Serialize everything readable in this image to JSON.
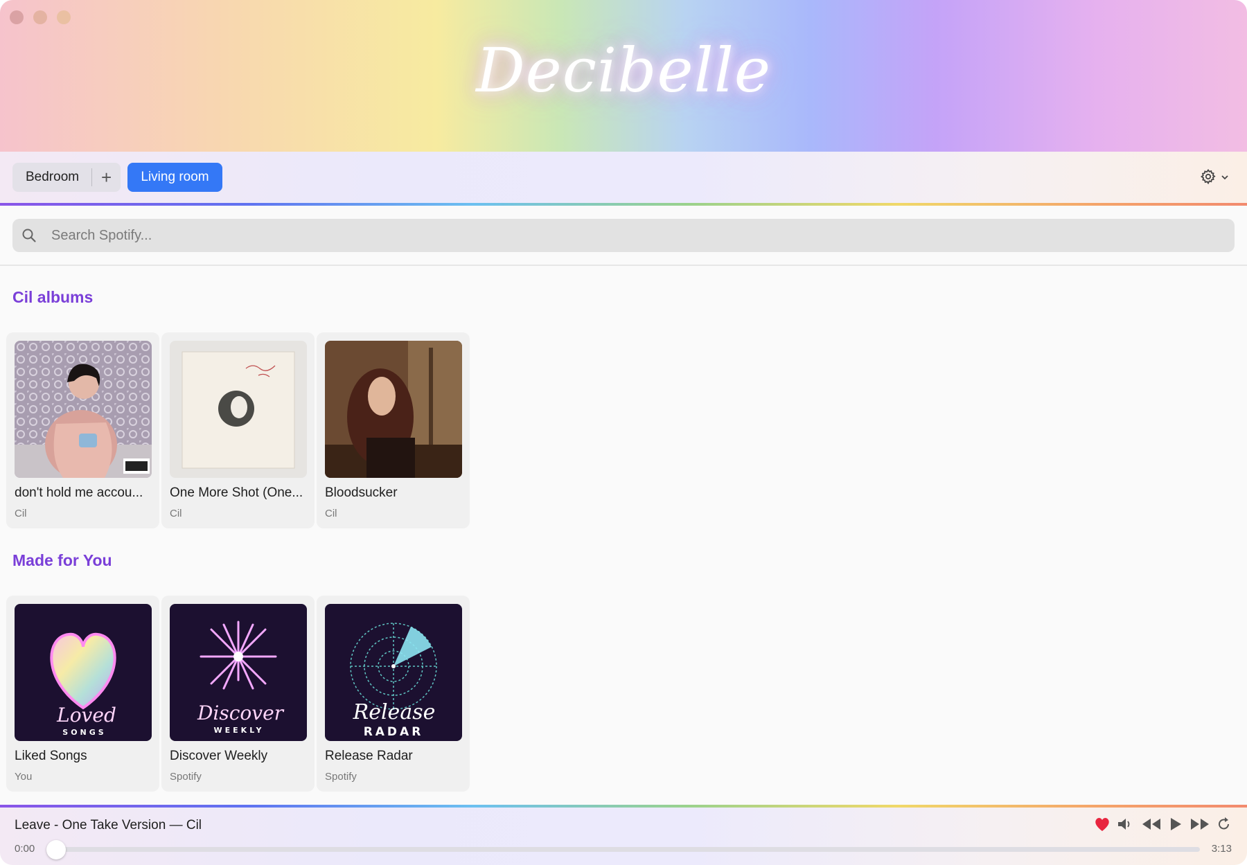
{
  "app": {
    "title": "Decibelle"
  },
  "toolbar": {
    "rooms": [
      "Bedroom"
    ],
    "add_label": "+",
    "active_room": "Living room"
  },
  "search": {
    "placeholder": "Search Spotify..."
  },
  "sections": [
    {
      "title": "Cil albums",
      "items": [
        {
          "title": "don't hold me accou...",
          "subtitle": "Cil"
        },
        {
          "title": "One More Shot (One...",
          "subtitle": "Cil"
        },
        {
          "title": "Bloodsucker",
          "subtitle": "Cil"
        }
      ]
    },
    {
      "title": "Made for You",
      "items": [
        {
          "title": "Liked Songs",
          "subtitle": "You",
          "art_script": "Loved",
          "art_caption": "SONGS"
        },
        {
          "title": "Discover Weekly",
          "subtitle": "Spotify",
          "art_script": "Discover",
          "art_caption": "WEEKLY"
        },
        {
          "title": "Release Radar",
          "subtitle": "Spotify",
          "art_script": "Release",
          "art_caption": "RADAR"
        }
      ]
    }
  ],
  "player": {
    "now_playing": "Leave - One Take Version — Cil",
    "time_current": "0:00",
    "time_total": "3:13",
    "progress": 0,
    "liked": true,
    "icons": [
      "heart-icon",
      "volume-icon",
      "rewind-icon",
      "play-icon",
      "fast-forward-icon",
      "repeat-icon"
    ]
  },
  "colors": {
    "accent": "#3478f6",
    "section_title": "#7a3fd8",
    "heart": "#e8253f"
  }
}
